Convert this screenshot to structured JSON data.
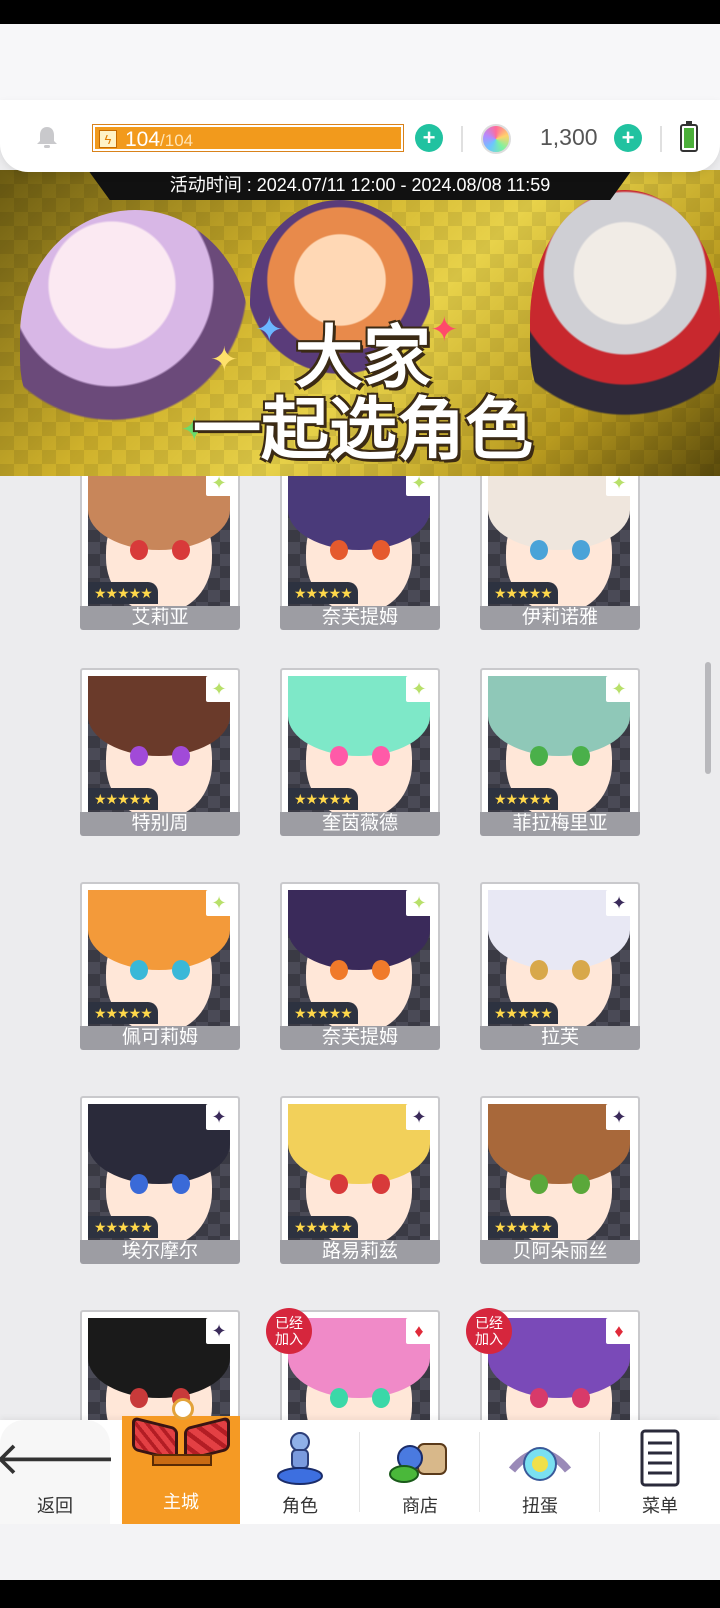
{
  "topbar": {
    "stamina_current": "104",
    "stamina_max": "/104",
    "gem_amount": "1,300",
    "icons": [
      "bell-icon",
      "lightning-icon",
      "plus-icon",
      "gem-icon",
      "battery-icon"
    ],
    "colors": {
      "stamina": "#f29a1c",
      "plus": "#21c2a0"
    }
  },
  "banner": {
    "event_time": "活动时间 : 2024.07/11 12:00 - 2024.08/08 11:59",
    "title_line1": "大家",
    "title_line2": "一起选角色"
  },
  "characters": [
    {
      "name": "艾莉亚",
      "rank": "✦",
      "rank_icon": "sparkle-rank-icon",
      "stars": "★★★★★",
      "joined": "",
      "hair": "#c8865a",
      "eye": "#d83a3a"
    },
    {
      "name": "奈芙提姆",
      "rank": "✦",
      "rank_icon": "sparkle-rank-icon",
      "stars": "★★★★★",
      "joined": "",
      "hair": "#4a3a7a",
      "eye": "#e55a2e"
    },
    {
      "name": "伊莉诺雅",
      "rank": "✦",
      "rank_icon": "sparkle-rank-icon",
      "stars": "★★★★★",
      "joined": "",
      "hair": "#efe6dd",
      "eye": "#4aa3d8"
    },
    {
      "name": "特别周",
      "rank": "✦",
      "rank_icon": "sparkle-rank-icon",
      "stars": "★★★★★",
      "joined": "",
      "hair": "#6a3a2a",
      "eye": "#a14ad8"
    },
    {
      "name": "奎茵薇德",
      "rank": "✦",
      "rank_icon": "sparkle-rank-icon",
      "stars": "★★★★★",
      "joined": "",
      "hair": "#7ee8c8",
      "eye": "#ff5aa8"
    },
    {
      "name": "菲拉梅里亚",
      "rank": "✦",
      "rank_icon": "sparkle-rank-icon",
      "stars": "★★★★★",
      "joined": "",
      "hair": "#8fc8b8",
      "eye": "#4ab04a"
    },
    {
      "name": "佩可莉姆",
      "rank": "✦",
      "rank_icon": "sparkle-rank-icon",
      "stars": "★★★★★",
      "joined": "",
      "hair": "#f39a3a",
      "eye": "#3ab8d8"
    },
    {
      "name": "奈芙提姆",
      "rank": "✦",
      "rank_icon": "sparkle-rank-icon",
      "stars": "★★★★★",
      "joined": "",
      "hair": "#3a2a5a",
      "eye": "#f07a2a"
    },
    {
      "name": "拉芙",
      "rank": "✦",
      "rank_icon": "dark-star-rank-icon",
      "stars": "★★★★★",
      "joined": "",
      "hair": "#e8e8f4",
      "eye": "#d8a84a"
    },
    {
      "name": "埃尔摩尔",
      "rank": "✦",
      "rank_icon": "dark-star-rank-icon",
      "stars": "★★★★★",
      "joined": "",
      "hair": "#2a2a3a",
      "eye": "#3a6ad8"
    },
    {
      "name": "路易莉兹",
      "rank": "✦",
      "rank_icon": "dark-star-rank-icon",
      "stars": "★★★★★",
      "joined": "",
      "hair": "#f2d05a",
      "eye": "#d83a3a"
    },
    {
      "name": "贝阿朵丽丝",
      "rank": "✦",
      "rank_icon": "dark-star-rank-icon",
      "stars": "★★★★★",
      "joined": "",
      "hair": "#a8683a",
      "eye": "#5aa83a"
    },
    {
      "name": "",
      "rank": "✦",
      "rank_icon": "dark-star-rank-icon",
      "stars": "★★★★★",
      "joined": "",
      "hair": "#1a1a1a",
      "eye": "#c83a3a"
    },
    {
      "name": "",
      "rank": "♦",
      "rank_icon": "diamond-rank-icon",
      "stars": "★★★★★",
      "joined": "已经\n加入",
      "hair": "#f08ac8",
      "eye": "#3ad8a8"
    },
    {
      "name": "",
      "rank": "♦",
      "rank_icon": "diamond-rank-icon",
      "stars": "★★★★★",
      "joined": "已经\n加入",
      "hair": "#7a4ab8",
      "eye": "#d83a6a"
    }
  ],
  "nav": {
    "back": "返回",
    "home": "主城",
    "chars": "角色",
    "shop": "商店",
    "gacha": "扭蛋",
    "menu": "菜单",
    "active": "home"
  }
}
